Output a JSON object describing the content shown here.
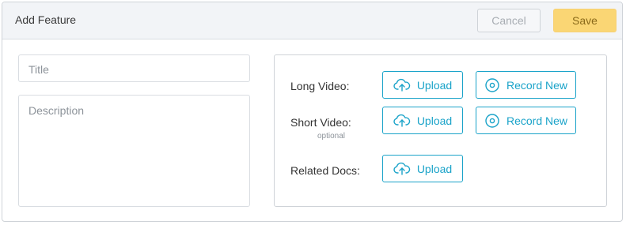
{
  "header": {
    "title": "Add Feature",
    "cancel_label": "Cancel",
    "save_label": "Save"
  },
  "form": {
    "title_placeholder": "Title",
    "description_placeholder": "Description"
  },
  "media": {
    "rows": [
      {
        "label": "Long Video:",
        "sublabel": "",
        "upload_label": "Upload",
        "record_label": "Record New"
      },
      {
        "label": "Short Video:",
        "sublabel": "optional",
        "upload_label": "Upload",
        "record_label": "Record New"
      },
      {
        "label": "Related Docs:",
        "sublabel": "",
        "upload_label": "Upload"
      }
    ]
  },
  "icons": {
    "upload": "cloud-upload-icon",
    "record": "record-disc-icon"
  },
  "colors": {
    "accent": "#1aa3c9",
    "save_bg": "#fad674",
    "header_bg": "#f2f4f7"
  }
}
